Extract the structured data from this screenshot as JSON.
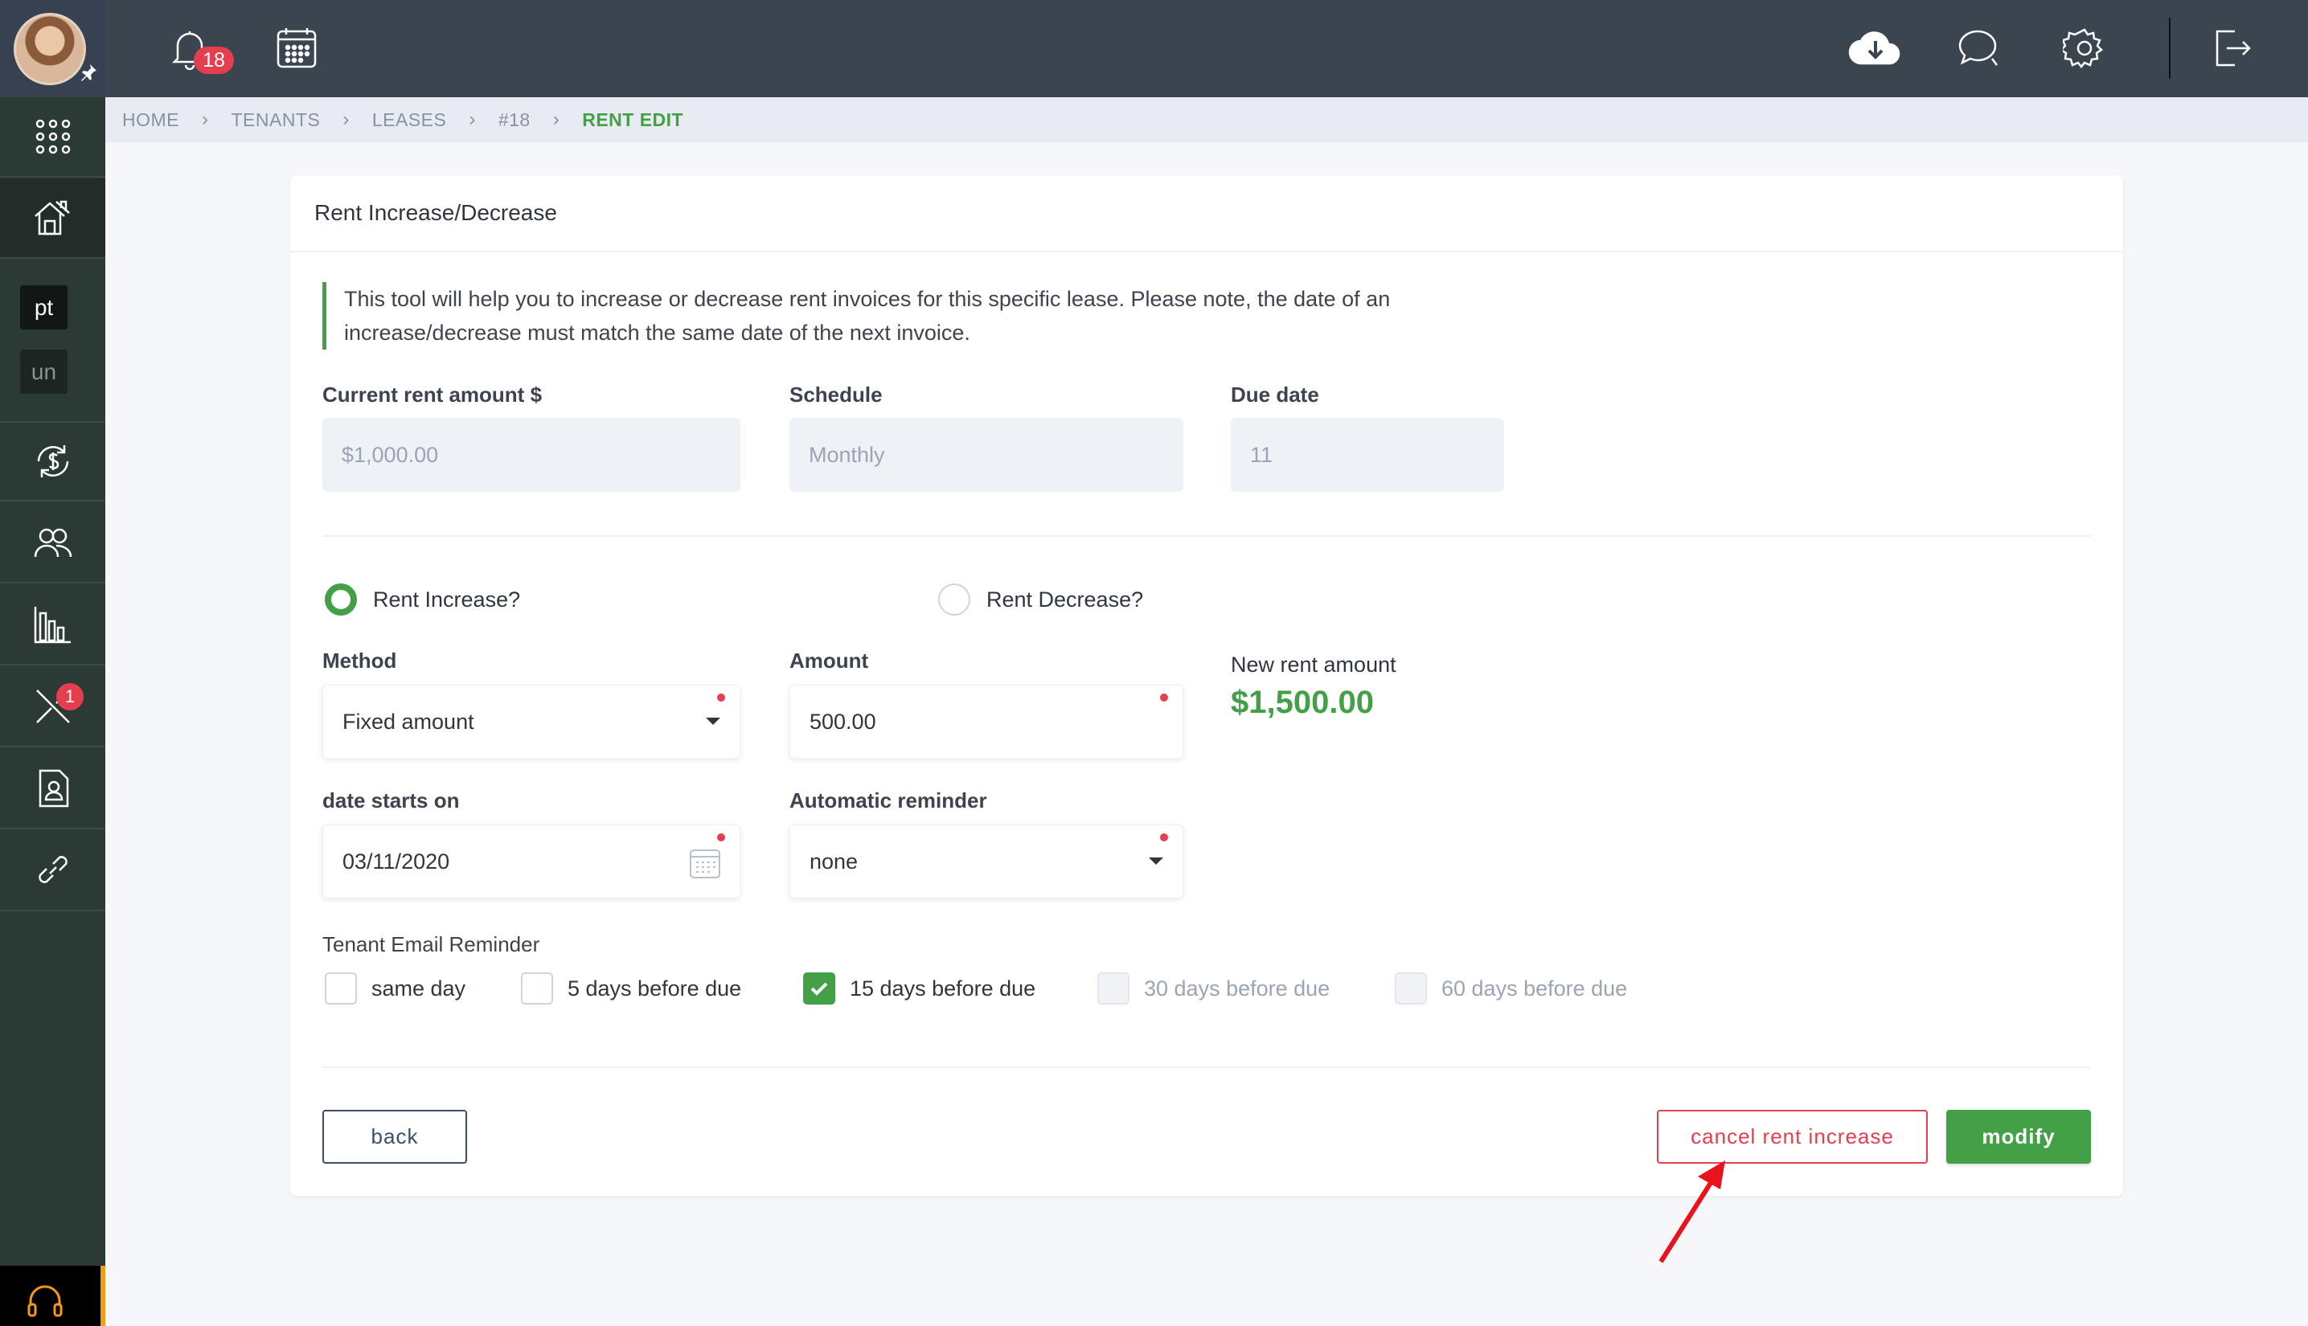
{
  "topbar": {
    "notification_count": "18"
  },
  "sidebar": {
    "chip_pt": "pt",
    "chip_un": "un",
    "tools_badge": "1"
  },
  "breadcrumb": {
    "items": [
      "HOME",
      "TENANTS",
      "LEASES",
      "#18",
      "RENT EDIT"
    ]
  },
  "card": {
    "title": "Rent Increase/Decrease",
    "notice": "This tool will help you to increase or decrease rent invoices for this specific lease. Please note, the date of an increase/decrease must match the same date of the next invoice."
  },
  "current": {
    "rent_label": "Current rent amount $",
    "rent_value": "$1,000.00",
    "schedule_label": "Schedule",
    "schedule_value": "Monthly",
    "due_label": "Due date",
    "due_value": "11"
  },
  "options": {
    "increase_label": "Rent Increase?",
    "decrease_label": "Rent Decrease?",
    "selected": "increase"
  },
  "form": {
    "method_label": "Method",
    "method_value": "Fixed amount",
    "amount_label": "Amount",
    "amount_value": "500.00",
    "new_rent_label": "New rent amount",
    "new_rent_value": "$1,500.00",
    "date_label": "date starts on",
    "date_value": "03/11/2020",
    "reminder_label": "Automatic reminder",
    "reminder_value": "none"
  },
  "email_reminder": {
    "label": "Tenant Email Reminder",
    "options": [
      {
        "label": "same day",
        "checked": false,
        "disabled": false
      },
      {
        "label": "5 days before due",
        "checked": false,
        "disabled": false
      },
      {
        "label": "15 days before due",
        "checked": true,
        "disabled": false
      },
      {
        "label": "30 days before due",
        "checked": false,
        "disabled": true
      },
      {
        "label": "60 days before due",
        "checked": false,
        "disabled": true
      }
    ]
  },
  "buttons": {
    "back": "back",
    "cancel": "cancel rent increase",
    "modify": "modify"
  },
  "colors": {
    "accent_green": "#43a047",
    "danger_red": "#e53e4f",
    "topbar": "#3b4550",
    "sidebar": "#2c3a35"
  }
}
